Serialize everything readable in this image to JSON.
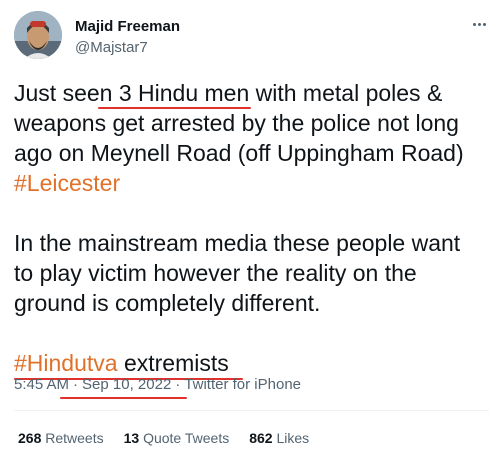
{
  "author": {
    "display_name": "Majid Freeman",
    "handle": "@Majstar7",
    "avatar_icon": "user-avatar"
  },
  "more_icon": "ellipsis-icon",
  "tweet": {
    "line1_pre": "Just see",
    "line1_underlined": "n 3 Hindu men",
    "line1_post": " with metal poles &",
    "line2": "weapons get arrested by the police not long",
    "line3": "ago on Meynell Road (off Uppingham Road)",
    "hashtag_leicester": "#Leicester",
    "para2_line1": "In the mainstream media these people want",
    "para2_line2": "to play victim however the reality on the",
    "para2_line3": "ground is completely different.",
    "hashtag_hindutva": "#Hindutva",
    "extremists": " extremists"
  },
  "meta": {
    "time": "5:45 AM",
    "date": "Sep 10, 2022",
    "source": "Twitter for iPhone",
    "separator": "·"
  },
  "stats": {
    "retweets_count": "268",
    "retweets_label": "Retweets",
    "quotes_count": "13",
    "quotes_label": "Quote Tweets",
    "likes_count": "862",
    "likes_label": "Likes"
  },
  "colors": {
    "hashtag": "#e0712a",
    "annotation_red": "#e0312a",
    "secondary_text": "#536471"
  }
}
